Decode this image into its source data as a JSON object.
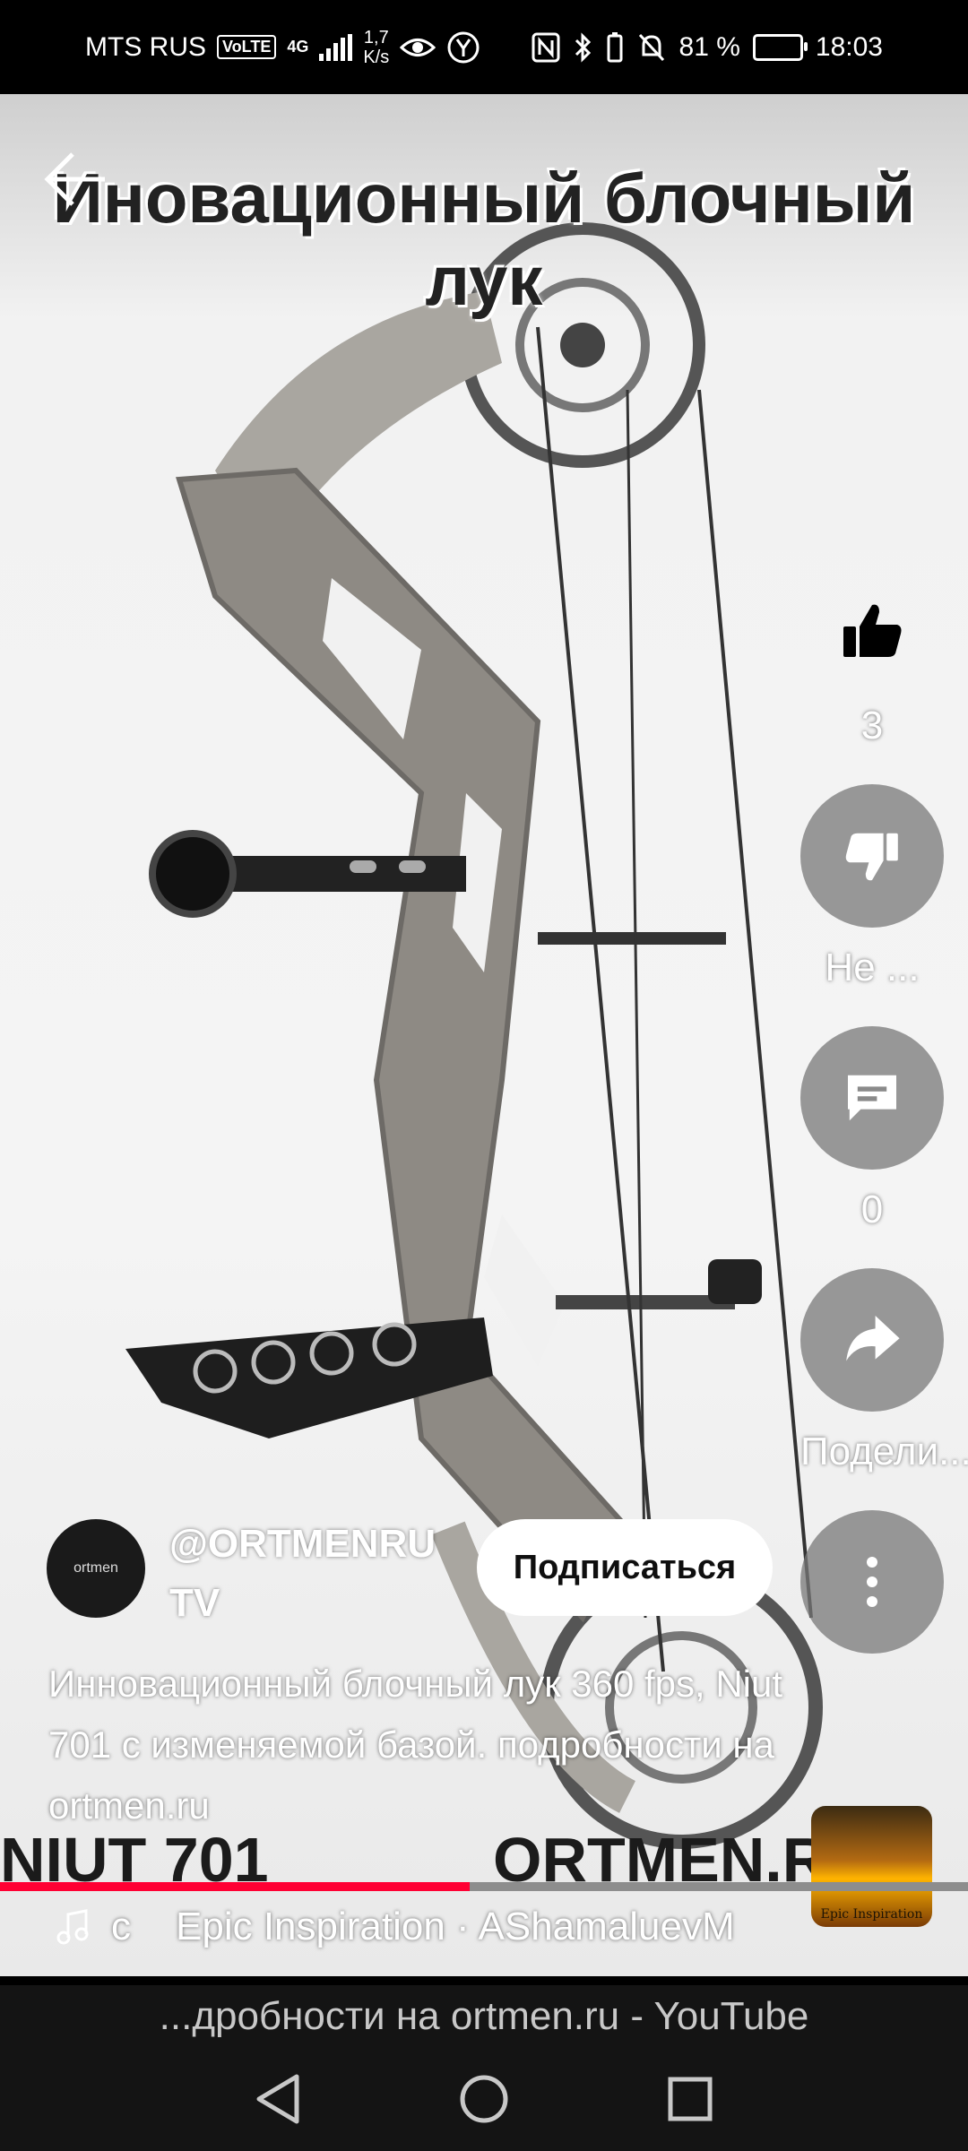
{
  "status_bar": {
    "carrier": "MTS RUS",
    "volte": "VoLTE",
    "network": "4G",
    "net_speed_value": "1,7",
    "net_speed_unit": "K/s",
    "battery": "81 %",
    "time": "18:03"
  },
  "video": {
    "overlay_title": "Иновационный блочный лук",
    "banner_left": "NIUT 701",
    "banner_right": "ORTMEN.RU"
  },
  "actions": {
    "likes": "3",
    "dislike_label": "Не ...",
    "comments": "0",
    "share_label": "Подели..."
  },
  "channel": {
    "name": "@ORTMENRU TV",
    "subscribe_label": "Подписаться",
    "avatar_text": "ortmen"
  },
  "description": "Инновационный блочный лук 360 fps,  Niut 701 с изменяемой базой. подробности на ortmen.ru",
  "music": {
    "prefix": "с",
    "track": "Epic Inspiration · AShamaluevM"
  },
  "music_thumb_label": "Epic Inspiration",
  "progress": {
    "fraction": 0.485,
    "fill_color": "#ff0033"
  },
  "browser": {
    "url_title": "...дробности на ortmen.ru - YouTube"
  },
  "icons": {
    "back": "arrow-left-icon",
    "like": "thumbs-up-icon",
    "dislike": "thumbs-down-icon",
    "comment": "comment-icon",
    "share": "share-arrow-icon",
    "more": "more-vertical-icon",
    "music": "music-note-icon"
  }
}
